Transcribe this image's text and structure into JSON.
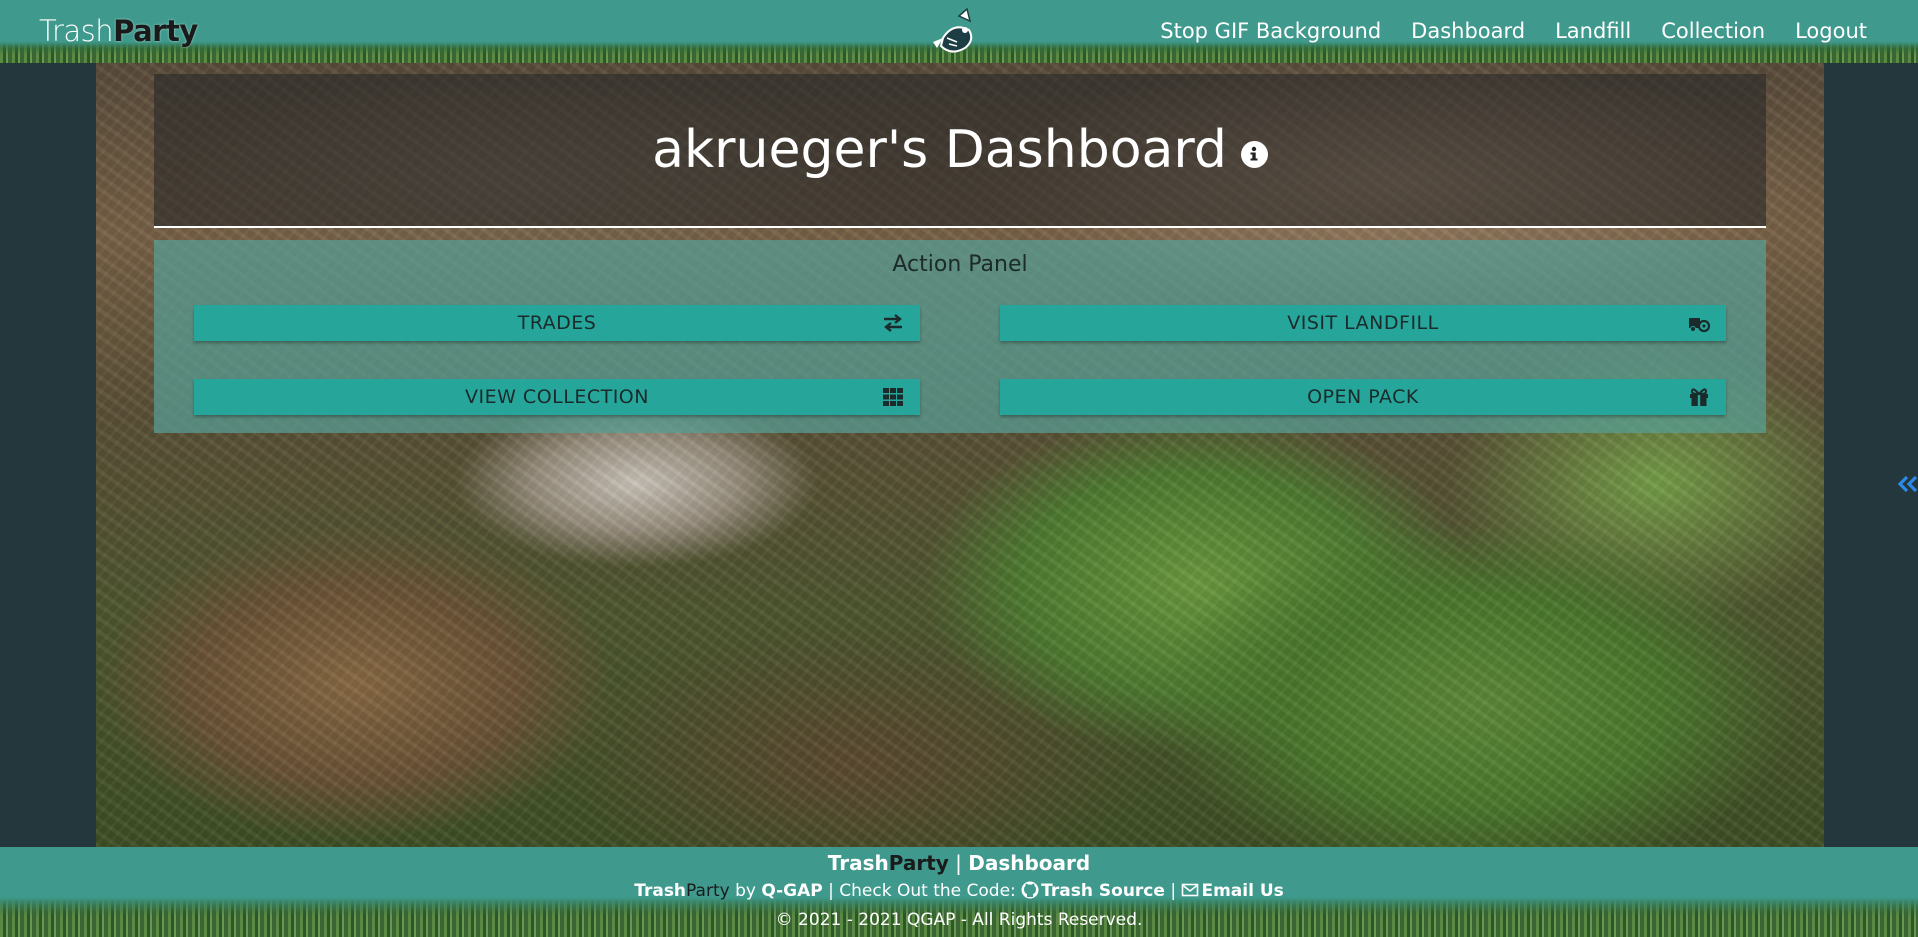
{
  "navbar": {
    "brand_light": "Trash",
    "brand_bold": "Party",
    "links": [
      "Stop GIF Background",
      "Dashboard",
      "Landfill",
      "Collection",
      "Logout"
    ]
  },
  "header": {
    "title": "akrueger's Dashboard"
  },
  "action_panel": {
    "title": "Action Panel",
    "buttons": {
      "trades": "TRADES",
      "visit_landfill": "VISIT LANDFILL",
      "view_collection": "VIEW COLLECTION",
      "open_pack": "OPEN PACK"
    }
  },
  "footer": {
    "line1_brand_a": "Trash",
    "line1_brand_b": "Party",
    "line1_sep": " | ",
    "line1_page": "Dashboard",
    "line2_brand_a": "Trash",
    "line2_brand_b": "Party",
    "line2_by": " by ",
    "line2_org": "Q-GAP",
    "line2_check": " | Check Out the Code: ",
    "line2_source": "Trash Source",
    "line2_sep": " | ",
    "line2_email": "Email Us",
    "line3": "© 2021 - 2021 QGAP - All Rights Reserved."
  },
  "colors": {
    "teal_bar": "#3f9a8d",
    "button": "#26a69a",
    "panel": "#57a096",
    "page_bg": "#24373c"
  },
  "icons": {
    "trades": "exchange-arrows-icon",
    "visit_landfill": "truck-recycle-icon",
    "view_collection": "grid-icon",
    "open_pack": "gift-icon",
    "info": "info-circle-icon",
    "github": "github-icon",
    "email": "envelope-icon",
    "side": "double-chevron-left-icon"
  }
}
